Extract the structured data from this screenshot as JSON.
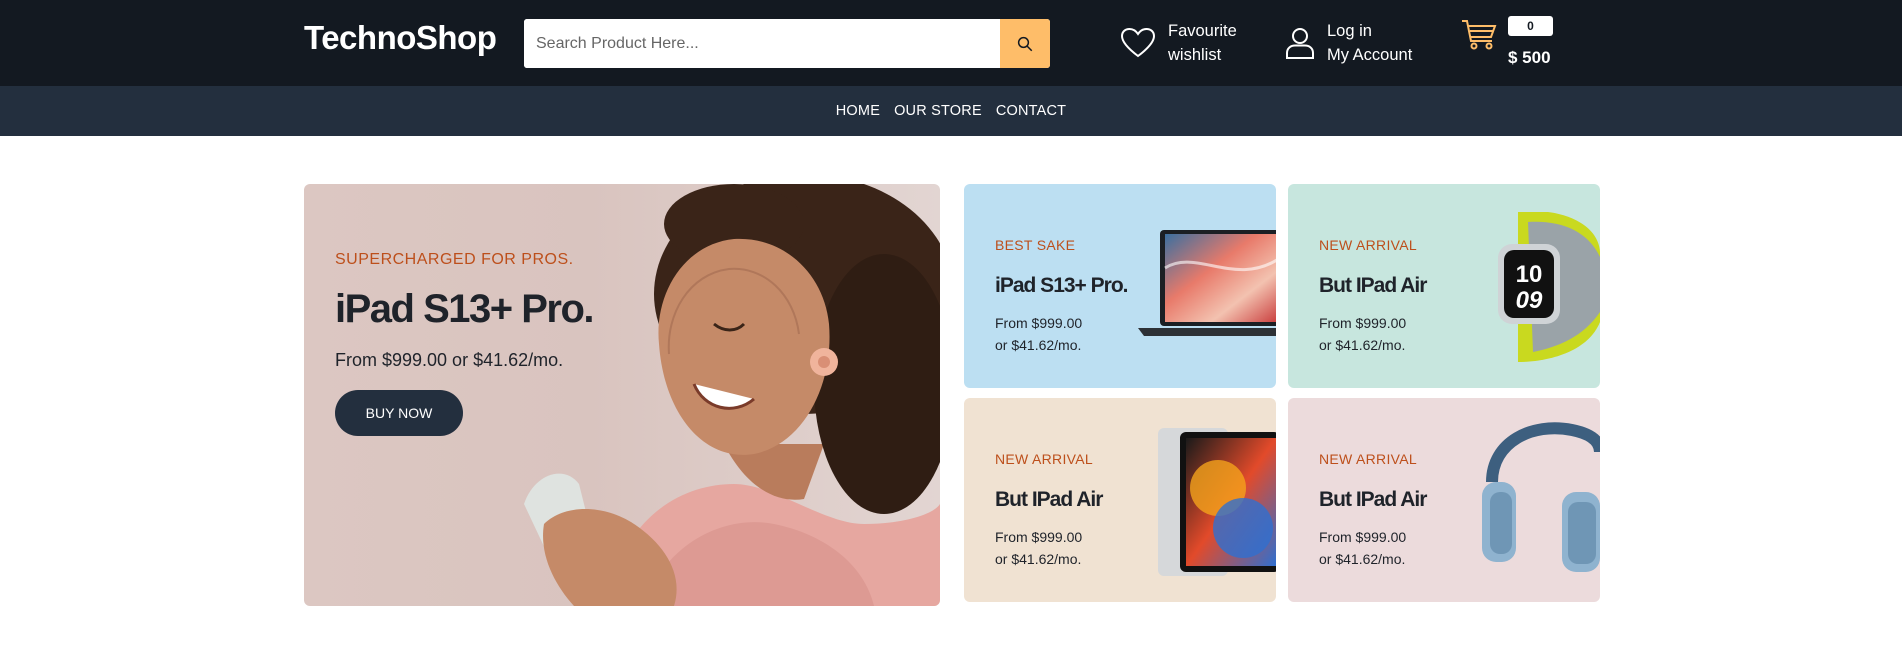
{
  "header": {
    "logo": "TechnoShop",
    "search_placeholder": "Search Product Here...",
    "favourite_line1": "Favourite",
    "favourite_line2": "wishlist",
    "login_line1": "Log in",
    "login_line2": "My Account",
    "cart_count": "0",
    "cart_total": "$ 500"
  },
  "nav": {
    "items": [
      "HOME",
      "OUR STORE",
      "CONTACT"
    ]
  },
  "hero": {
    "tag": "SUPERCHARGED FOR PROS.",
    "title": "iPad S13+ Pro.",
    "price": "From $999.00 or $41.62/mo.",
    "button": "BUY NOW"
  },
  "cards": [
    {
      "tag": "BEST SAKE",
      "title": "iPad S13+ Pro.",
      "price1": "From $999.00",
      "price2": "or $41.62/mo.",
      "image": "laptop"
    },
    {
      "tag": "NEW ARRIVAL",
      "title": "But IPad Air",
      "price1": "From $999.00",
      "price2": "or $41.62/mo.",
      "image": "smartwatch"
    },
    {
      "tag": "NEW ARRIVAL",
      "title": "But IPad Air",
      "price1": "From $999.00",
      "price2": "or $41.62/mo.",
      "image": "tablet"
    },
    {
      "tag": "NEW ARRIVAL",
      "title": "But IPad Air",
      "price1": "From $999.00",
      "price2": "or $41.62/mo.",
      "image": "headphones"
    }
  ],
  "colors": {
    "topbar": "#131921",
    "navbar": "#232f3e",
    "accent": "#febd69",
    "tag": "#bd4f1b"
  }
}
